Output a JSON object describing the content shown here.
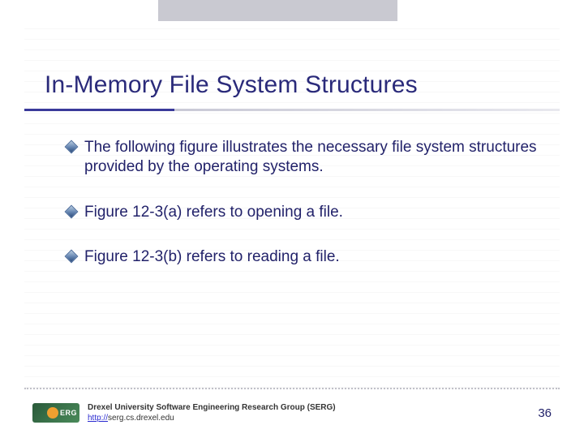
{
  "title": "In-Memory File System Structures",
  "bullets": [
    "The following figure illustrates the necessary file system structures provided by the operating systems.",
    "Figure 12-3(a) refers to opening a file.",
    "Figure 12-3(b) refers to reading a file."
  ],
  "footer": {
    "org": "Drexel University Software Engineering Research Group (SERG)",
    "link_prefix": "http://",
    "link_rest": "serg.cs.drexel.edu",
    "logo_label": "ERG"
  },
  "page_number": "36"
}
